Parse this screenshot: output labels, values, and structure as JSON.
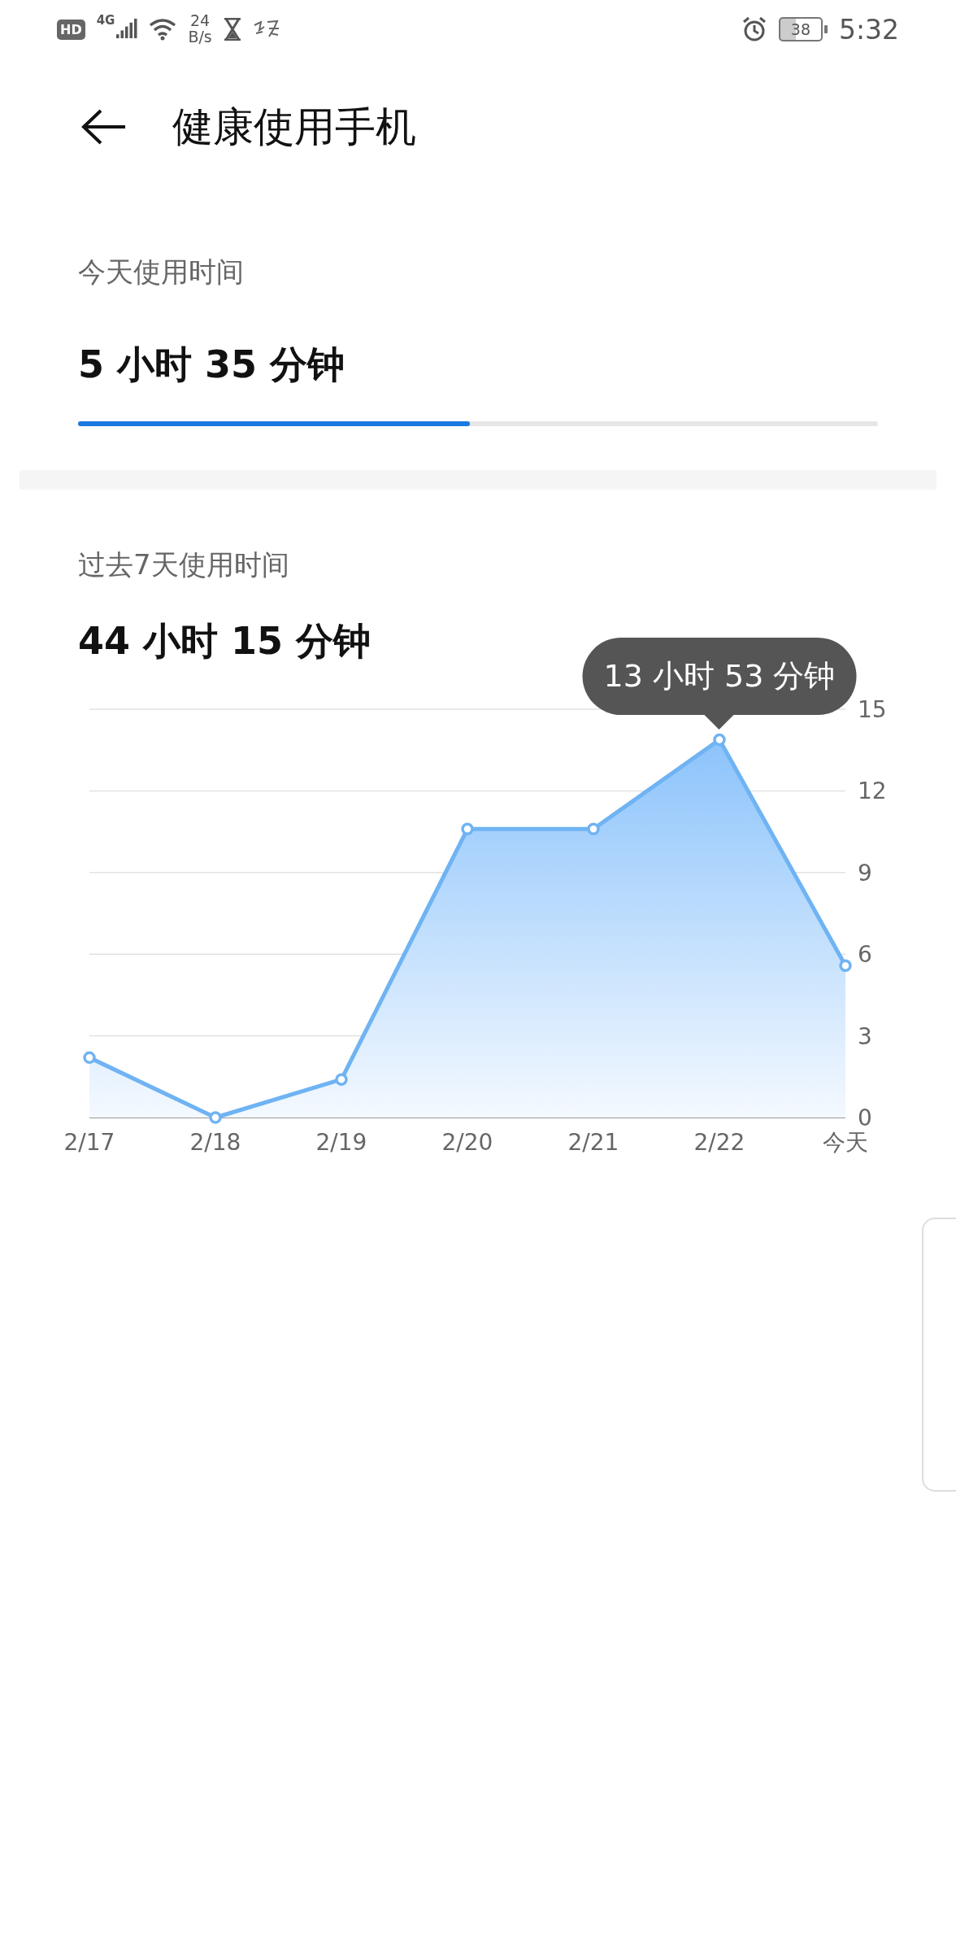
{
  "status_bar": {
    "network_badge": "HD",
    "network_type": "4G",
    "speed_value": "24",
    "speed_unit": "B/s",
    "battery": "38",
    "time": "5:32"
  },
  "header": {
    "title": "健康使用手机"
  },
  "today": {
    "label": "今天使用时间",
    "value": "5 小时 35 分钟",
    "level": 0.49
  },
  "week": {
    "label": "过去7天使用时间",
    "value": "44 小时 15 分钟",
    "chart_data": {
      "type": "area",
      "categories": [
        "2/17",
        "2/18",
        "2/19",
        "2/20",
        "2/21",
        "2/22",
        "今天"
      ],
      "series": [
        {
          "color": "#6fb3f3",
          "values": [
            2.2,
            0,
            1.4,
            10.6,
            10.6,
            13.88,
            5.58
          ]
        }
      ],
      "ylim": [
        0,
        15
      ],
      "yticks": [
        0,
        3,
        6,
        9,
        12,
        15
      ],
      "grid": true
    },
    "tooltip": {
      "text": "13 小时 53 分钟"
    }
  }
}
